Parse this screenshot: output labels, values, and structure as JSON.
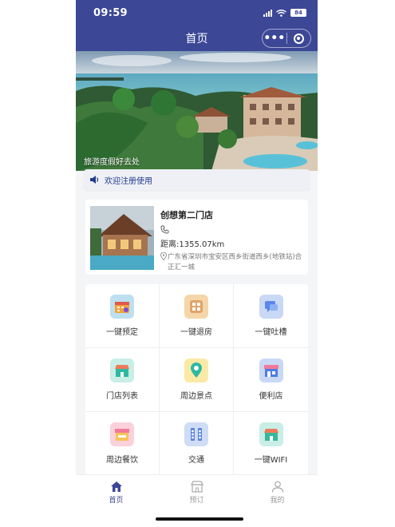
{
  "status_bar": {
    "time": "09:59",
    "battery": "84"
  },
  "nav": {
    "title": "首页",
    "more_icon": "more-dots-icon",
    "close_icon": "target-close-icon"
  },
  "banner": {
    "caption": "旅游度假好去处"
  },
  "notice": {
    "text": "欢迎注册使用",
    "icon": "speaker-icon"
  },
  "store": {
    "name": "创想第二门店",
    "phone_icon": "phone-icon",
    "distance": "距离:1355.07km",
    "address": "广东省深圳市宝安区西乡街道西乡(地铁站)合正汇一城",
    "address_icon": "location-pin-icon"
  },
  "grid": {
    "items": [
      {
        "label": "一键预定",
        "icon": "calendar-icon",
        "color": "#f2a33a"
      },
      {
        "label": "一键退房",
        "icon": "building-icon",
        "color": "#e0a36a"
      },
      {
        "label": "一键吐槽",
        "icon": "chat-icon",
        "color": "#5b87e6"
      },
      {
        "label": "门店列表",
        "icon": "store-icon",
        "color": "#2db8a2"
      },
      {
        "label": "周边景点",
        "icon": "map-pin-icon",
        "color": "#f0c838"
      },
      {
        "label": "便利店",
        "icon": "shop-icon",
        "color": "#4e7ee0"
      },
      {
        "label": "周边餐饮",
        "icon": "restaurant-icon",
        "color": "#f07a9a"
      },
      {
        "label": "交通",
        "icon": "traffic-icon",
        "color": "#5a83d8"
      },
      {
        "label": "一键WIFI",
        "icon": "wifi-store-icon",
        "color": "#38b89a"
      }
    ]
  },
  "tabbar": {
    "items": [
      {
        "label": "首页",
        "icon": "home-icon",
        "active": true
      },
      {
        "label": "预订",
        "icon": "booking-icon",
        "active": false
      },
      {
        "label": "我的",
        "icon": "profile-icon",
        "active": false
      }
    ]
  },
  "colors": {
    "primary": "#3c4796",
    "background": "#f4f5f7"
  }
}
